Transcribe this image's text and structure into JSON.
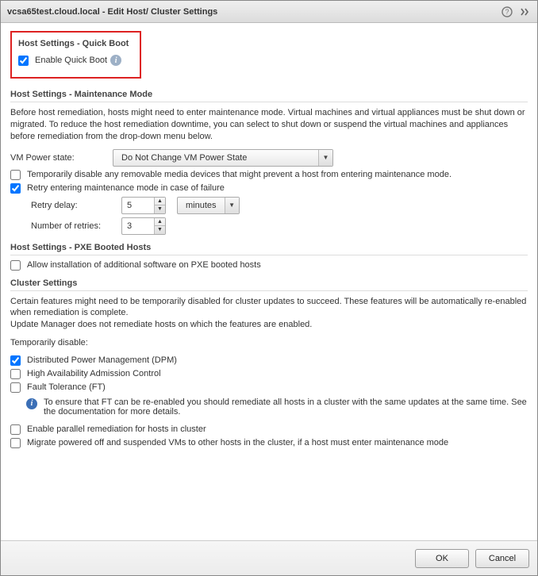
{
  "titlebar": {
    "title": "vcsa65test.cloud.local - Edit Host/ Cluster Settings"
  },
  "quickBoot": {
    "sectionTitle": "Host Settings - Quick Boot",
    "enableLabel": "Enable Quick Boot"
  },
  "maint": {
    "sectionTitle": "Host Settings - Maintenance Mode",
    "desc": "Before host remediation, hosts might need to enter maintenance mode. Virtual machines and virtual appliances must be shut down or migrated. To reduce the host remediation downtime, you can select to shut down or suspend the virtual machines and appliances before remediation from the drop-down menu below.",
    "powerLabel": "VM Power state:",
    "powerValue": "Do Not Change VM Power State",
    "tempDisableMedia": "Temporarily disable any removable media devices that might prevent a host from entering maintenance mode.",
    "retryLabel": "Retry entering maintenance mode in case of failure",
    "retryDelayLabel": "Retry delay:",
    "retryDelayValue": "5",
    "retryDelayUnit": "minutes",
    "numRetriesLabel": "Number of retries:",
    "numRetriesValue": "3"
  },
  "pxe": {
    "sectionTitle": "Host Settings - PXE Booted Hosts",
    "allowLabel": "Allow installation of additional software on PXE booted hosts"
  },
  "cluster": {
    "sectionTitle": "Cluster Settings",
    "desc1": "Certain features might need to be temporarily disabled for cluster updates to succeed. These features will be automatically re-enabled when remediation is complete.",
    "desc2": "Update Manager does not remediate hosts on which the features are enabled.",
    "tempDisableLabel": "Temporarily disable:",
    "dpm": "Distributed Power Management (DPM)",
    "hac": "High Availability Admission Control",
    "ft": "Fault Tolerance (FT)",
    "ftNote": "To ensure that FT can be re-enabled you should remediate all hosts in a cluster with the same updates at the same time. See the documentation for more details.",
    "parallel": "Enable parallel remediation for hosts in cluster",
    "migrate": "Migrate powered off and suspended VMs to other hosts in the cluster, if a host must enter maintenance mode"
  },
  "buttons": {
    "ok": "OK",
    "cancel": "Cancel"
  }
}
